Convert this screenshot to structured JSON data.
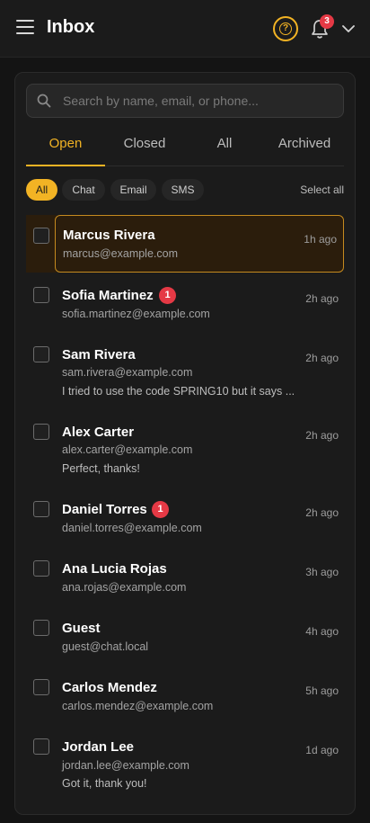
{
  "header": {
    "title": "Inbox",
    "notification_count": "3",
    "icons": {
      "menu": "hamburger-menu-icon",
      "help": "help-circle-icon",
      "bell": "bell-icon",
      "account": "chevron-down-icon"
    },
    "accent_color": "#f2b324"
  },
  "search": {
    "placeholder": "Search by name, email, or phone..."
  },
  "tabs": [
    {
      "label": "Open",
      "active": true
    },
    {
      "label": "Closed",
      "active": false
    },
    {
      "label": "All",
      "active": false
    },
    {
      "label": "Archived",
      "active": false
    }
  ],
  "filters": {
    "chips": [
      {
        "label": "All",
        "active": true
      },
      {
        "label": "Chat",
        "active": false
      },
      {
        "label": "Email",
        "active": false
      },
      {
        "label": "SMS",
        "active": false
      }
    ],
    "select_all": "Select all"
  },
  "conversations": [
    {
      "name": "Marcus Rivera",
      "email": "marcus@example.com",
      "time": "1h ago",
      "unread": "",
      "preview": "",
      "selected": true
    },
    {
      "name": "Sofia Martinez",
      "email": "sofia.martinez@example.com",
      "time": "2h ago",
      "unread": "1",
      "preview": ""
    },
    {
      "name": "Sam Rivera",
      "email": "sam.rivera@example.com",
      "time": "2h ago",
      "unread": "",
      "preview": "I tried to use the code SPRING10 but it says ..."
    },
    {
      "name": "Alex Carter",
      "email": "alex.carter@example.com",
      "time": "2h ago",
      "unread": "",
      "preview": "Perfect, thanks!"
    },
    {
      "name": "Daniel Torres",
      "email": "daniel.torres@example.com",
      "time": "2h ago",
      "unread": "1",
      "preview": ""
    },
    {
      "name": "Ana Lucia Rojas",
      "email": "ana.rojas@example.com",
      "time": "3h ago",
      "unread": "",
      "preview": ""
    },
    {
      "name": "Guest",
      "email": "guest@chat.local",
      "time": "4h ago",
      "unread": "",
      "preview": ""
    },
    {
      "name": "Carlos Mendez",
      "email": "carlos.mendez@example.com",
      "time": "5h ago",
      "unread": "",
      "preview": ""
    },
    {
      "name": "Jordan Lee",
      "email": "jordan.lee@example.com",
      "time": "1d ago",
      "unread": "",
      "preview": "Got it, thank you!"
    }
  ]
}
